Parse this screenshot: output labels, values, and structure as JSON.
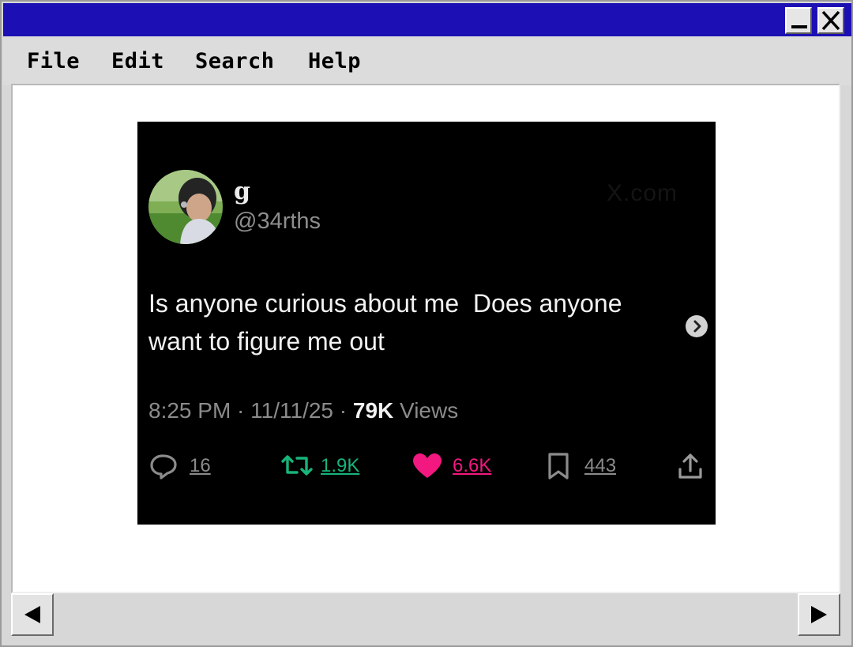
{
  "window": {
    "title": "",
    "title_bar_color": "#1c10b4",
    "controls": {
      "minimize_icon": "minimize-icon",
      "close_icon": "close-icon"
    }
  },
  "menubar": {
    "items": [
      {
        "label": "File"
      },
      {
        "label": "Edit"
      },
      {
        "label": "Search"
      },
      {
        "label": "Help"
      }
    ]
  },
  "tweet": {
    "display_name": "g",
    "handle": "@34rths",
    "watermark": "X.com",
    "text": "Is anyone curious about me  Does anyone\nwant to figure me out",
    "timestamp": "8:25 PM · 11/11/25 · ",
    "views_count": "79K",
    "views_label": " Views",
    "actions": {
      "replies": {
        "count": "16",
        "icon": "reply-icon",
        "color": "#8b8b8b"
      },
      "reposts": {
        "count": "1.9K",
        "icon": "repost-icon",
        "color": "#18b47a"
      },
      "likes": {
        "count": "6.6K",
        "icon": "heart-icon",
        "color": "#f2187f"
      },
      "bookmarks": {
        "count": "443",
        "icon": "bookmark-icon",
        "color": "#8b8b8b"
      },
      "share": {
        "icon": "share-icon"
      }
    }
  },
  "scrollbar": {
    "left_icon": "arrow-left-icon",
    "right_icon": "arrow-right-icon"
  }
}
